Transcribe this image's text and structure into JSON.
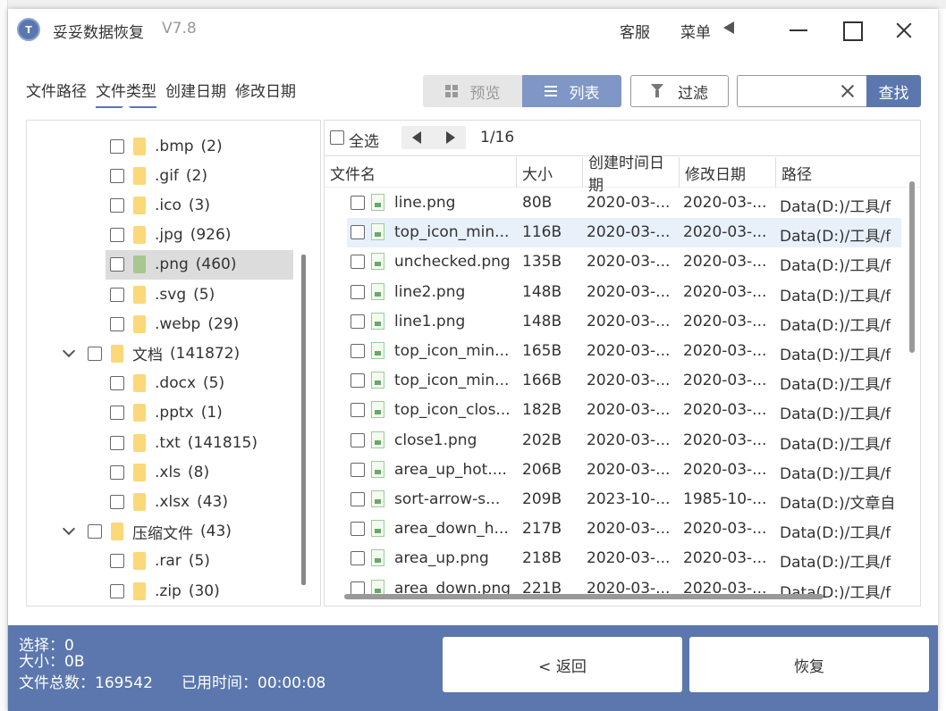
{
  "app": {
    "title": "妥妥数据恢复",
    "version": "V7.8",
    "logo_text": "T",
    "service_label": "客服",
    "menu_label": "菜单"
  },
  "tabs": [
    {
      "label": "文件路径",
      "active": false
    },
    {
      "label": "文件类型",
      "active": true
    },
    {
      "label": "创建日期",
      "active": false
    },
    {
      "label": "修改日期",
      "active": false
    }
  ],
  "toolbar": {
    "preview_label": "预览",
    "list_label": "列表",
    "filter_label": "过滤",
    "search_value": "",
    "search_button": "查找"
  },
  "tree": {
    "items": [
      {
        "label": ".bmp",
        "count": "(2)",
        "level": 2,
        "folder_color": "yellow",
        "selected": false
      },
      {
        "label": ".gif",
        "count": "(2)",
        "level": 2,
        "folder_color": "yellow",
        "selected": false
      },
      {
        "label": ".ico",
        "count": "(3)",
        "level": 2,
        "folder_color": "yellow",
        "selected": false
      },
      {
        "label": ".jpg",
        "count": "(926)",
        "level": 2,
        "folder_color": "yellow",
        "selected": false
      },
      {
        "label": ".png",
        "count": "(460)",
        "level": 2,
        "folder_color": "green",
        "selected": true
      },
      {
        "label": ".svg",
        "count": "(5)",
        "level": 2,
        "folder_color": "yellow",
        "selected": false
      },
      {
        "label": ".webp",
        "count": "(29)",
        "level": 2,
        "folder_color": "yellow",
        "selected": false
      },
      {
        "label": "文档",
        "count": "(141872)",
        "level": 1,
        "folder_color": "yellow",
        "selected": false
      },
      {
        "label": ".docx",
        "count": "(5)",
        "level": 2,
        "folder_color": "yellow",
        "selected": false
      },
      {
        "label": ".pptx",
        "count": "(1)",
        "level": 2,
        "folder_color": "yellow",
        "selected": false
      },
      {
        "label": ".txt",
        "count": "(141815)",
        "level": 2,
        "folder_color": "yellow",
        "selected": false
      },
      {
        "label": ".xls",
        "count": "(8)",
        "level": 2,
        "folder_color": "yellow",
        "selected": false
      },
      {
        "label": ".xlsx",
        "count": "(43)",
        "level": 2,
        "folder_color": "yellow",
        "selected": false
      },
      {
        "label": "压缩文件",
        "count": "(43)",
        "level": 1,
        "folder_color": "yellow",
        "selected": false
      },
      {
        "label": ".rar",
        "count": "(5)",
        "level": 2,
        "folder_color": "yellow",
        "selected": false
      },
      {
        "label": ".zip",
        "count": "(30)",
        "level": 2,
        "folder_color": "yellow",
        "selected": false
      }
    ]
  },
  "list": {
    "select_all_label": "全选",
    "page_indicator": "1/16",
    "columns": [
      "文件名",
      "大小",
      "创建时间日期",
      "修改日期",
      "路径"
    ],
    "rows": [
      {
        "name": "line.png",
        "size": "80B",
        "created": "2020-03-...",
        "modified": "2020-03-...",
        "path": "Data(D:)/工具/f"
      },
      {
        "name": "top_icon_min...",
        "size": "116B",
        "created": "2020-03-...",
        "modified": "2020-03-...",
        "path": "Data(D:)/工具/f"
      },
      {
        "name": "unchecked.png",
        "size": "135B",
        "created": "2020-03-...",
        "modified": "2020-03-...",
        "path": "Data(D:)/工具/f"
      },
      {
        "name": "line2.png",
        "size": "148B",
        "created": "2020-03-...",
        "modified": "2020-03-...",
        "path": "Data(D:)/工具/f"
      },
      {
        "name": "line1.png",
        "size": "148B",
        "created": "2020-03-...",
        "modified": "2020-03-...",
        "path": "Data(D:)/工具/f"
      },
      {
        "name": "top_icon_min...",
        "size": "165B",
        "created": "2020-03-...",
        "modified": "2020-03-...",
        "path": "Data(D:)/工具/f"
      },
      {
        "name": "top_icon_min...",
        "size": "166B",
        "created": "2020-03-...",
        "modified": "2020-03-...",
        "path": "Data(D:)/工具/f"
      },
      {
        "name": "top_icon_clos...",
        "size": "182B",
        "created": "2020-03-...",
        "modified": "2020-03-...",
        "path": "Data(D:)/工具/f"
      },
      {
        "name": "close1.png",
        "size": "202B",
        "created": "2020-03-...",
        "modified": "2020-03-...",
        "path": "Data(D:)/工具/f"
      },
      {
        "name": "area_up_hot....",
        "size": "206B",
        "created": "2020-03-...",
        "modified": "2020-03-...",
        "path": "Data(D:)/工具/f"
      },
      {
        "name": "sort-arrow-s...",
        "size": "209B",
        "created": "2023-10-...",
        "modified": "1985-10-...",
        "path": "Data(D:)/文章自"
      },
      {
        "name": "area_down_h...",
        "size": "217B",
        "created": "2020-03-...",
        "modified": "2020-03-...",
        "path": "Data(D:)/工具/f"
      },
      {
        "name": "area_up.png",
        "size": "218B",
        "created": "2020-03-...",
        "modified": "2020-03-...",
        "path": "Data(D:)/工具/f"
      },
      {
        "name": "area_down.png",
        "size": "221B",
        "created": "2020-03-...",
        "modified": "2020-03-...",
        "path": "Data(D:)/工具/f"
      }
    ]
  },
  "footer": {
    "selected": "选择：0",
    "size": "大小：0B",
    "total": "文件总数：169542",
    "elapsed": "已用时间：00:00:08",
    "back_label": "< 返回",
    "recover_label": "恢复"
  },
  "colors": {
    "accent": "#5b77ad",
    "list_active": "#7f96c6",
    "row_hover": "#e8f0fa",
    "folder_yellow": "#fbd87a",
    "folder_green": "#a8c68f"
  }
}
